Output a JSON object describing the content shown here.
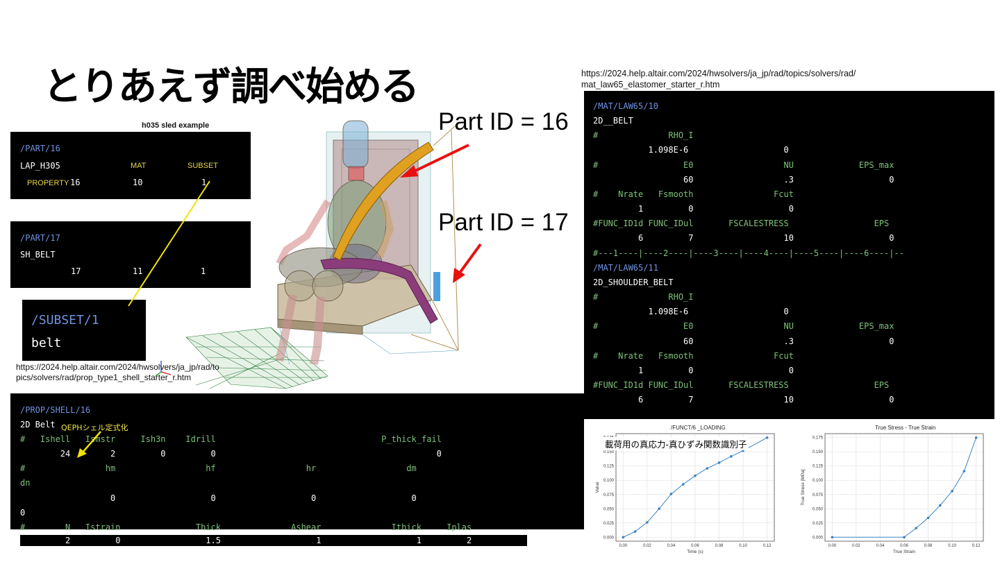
{
  "title": "とりあえず調べ始める",
  "urls": {
    "mat_line1": "https://2024.help.altair.com/2024/hwsolvers/ja_jp/rad/topics/solvers/rad/",
    "mat_line2": "mat_law65_elastomer_starter_r.htm",
    "prop_line1": "https://2024.help.altair.com/2024/hwsolvers/ja_jp/rad/to",
    "prop_line2": "pics/solvers/rad/prop_type1_shell_starter_r.htm"
  },
  "sled_caption": "h035 sled example",
  "part_labels": {
    "p16": "Part ID = 16",
    "p17": "Part ID = 17"
  },
  "part16": {
    "header": "/PART/16",
    "name": "LAP_H305",
    "mat_label": "MAT",
    "subset_label": "SUBSET",
    "property_label": "PROPERTY",
    "property": "16",
    "mat": "10",
    "subset": "1"
  },
  "part17": {
    "header": "/PART/17",
    "name": "SH_BELT",
    "property": "17",
    "mat": "11",
    "subset": "1"
  },
  "subset": {
    "header": "/SUBSET/1",
    "name": "belt"
  },
  "mat10": {
    "header": "/MAT/LAW65/10",
    "name": "2D__BELT",
    "rho_head": "#              RHO_I",
    "rho_vals": "           1.098E-6                   0",
    "e_head": "#                 E0                  NU             EPS_max",
    "e_vals": "                  60                  .3                   0",
    "n_head": "#    Nrate   Fsmooth                Fcut",
    "n_vals": "         1         0                   0",
    "f_head": "#FUNC_ID1d FUNC_IDul       FSCALESTRESS                 EPS",
    "f_vals": "         6         7                  10                   0",
    "sep": "#---1----|----2----|----3----|----4----|----5----|----6----|--"
  },
  "mat11": {
    "header": "/MAT/LAW65/11",
    "name": "2D_SHOULDER_BELT",
    "rho_head": "#              RHO_I",
    "rho_vals": "           1.098E-6                   0",
    "e_head": "#                 E0                  NU             EPS_max",
    "e_vals": "                  60                  .3                   0",
    "n_head": "#    Nrate   Fsmooth                Fcut",
    "n_vals": "         1         0                   0",
    "f_head": "#FUNC_ID1d FUNC_IDul       FSCALESTRESS                 EPS",
    "f_vals": "         6         7                  10                   0"
  },
  "prop": {
    "header": "/PROP/SHELL/16",
    "name": "2D Belt",
    "annotation": "QEPHシェル定式化",
    "l1_head": "#   Ishell   Ismstr     Ish3n    Idrill                                 P_thick_fail",
    "l1_vals": "        24        2         0         0                                            0",
    "l2_head": "#                hm                  hf                  hr                  dm",
    "l2_cont": "dn",
    "l3_vals": "                  0                   0                   0                   0",
    "l3_cont": "0",
    "l4_head": "#        N   Istrain               Thick              Ashear              Ithick     Iplas",
    "l4_vals": "         2         0                 1.5                   1                   1         2"
  },
  "chart_overlay_text": "載荷用の真応力-真ひずみ関数識別子",
  "chart_data": [
    {
      "type": "line",
      "title": "/FUNCT/6 _LOADING",
      "xlabel": "Time (s)",
      "ylabel": "Value",
      "x": [
        0.0,
        0.01,
        0.02,
        0.03,
        0.04,
        0.05,
        0.06,
        0.07,
        0.08,
        0.09,
        0.1,
        0.12
      ],
      "y": [
        0.0,
        0.01,
        0.026,
        0.05,
        0.076,
        0.093,
        0.108,
        0.121,
        0.131,
        0.142,
        0.152,
        0.175
      ],
      "xlim": [
        -0.006,
        0.126
      ],
      "ylim": [
        -0.007,
        0.182
      ],
      "xticks": [
        "0.00",
        "0.02",
        "0.04",
        "0.06",
        "0.08",
        "0.10",
        "0.12"
      ],
      "yticks": [
        "0.000",
        "0.025",
        "0.050",
        "0.075",
        "0.100",
        "0.125",
        "0.150",
        "0.175"
      ],
      "grid": true,
      "color": "#3b82c4"
    },
    {
      "type": "line",
      "title": "True Stress - True Strain",
      "xlabel": "True Strain",
      "ylabel": "True Stress [MPa]",
      "x": [
        0.0,
        0.06,
        0.07,
        0.08,
        0.09,
        0.1,
        0.11,
        0.12
      ],
      "y": [
        0.0,
        0.0,
        0.016,
        0.034,
        0.056,
        0.081,
        0.116,
        0.175
      ],
      "xlim": [
        -0.006,
        0.126
      ],
      "ylim": [
        -0.007,
        0.182
      ],
      "xticks": [
        "0.00",
        "0.02",
        "0.04",
        "0.06",
        "0.08",
        "0.10",
        "0.12"
      ],
      "yticks": [
        "0.000",
        "0.025",
        "0.050",
        "0.075",
        "0.100",
        "0.125",
        "0.150",
        "0.175"
      ],
      "grid": true,
      "color": "#3b82c4"
    }
  ]
}
